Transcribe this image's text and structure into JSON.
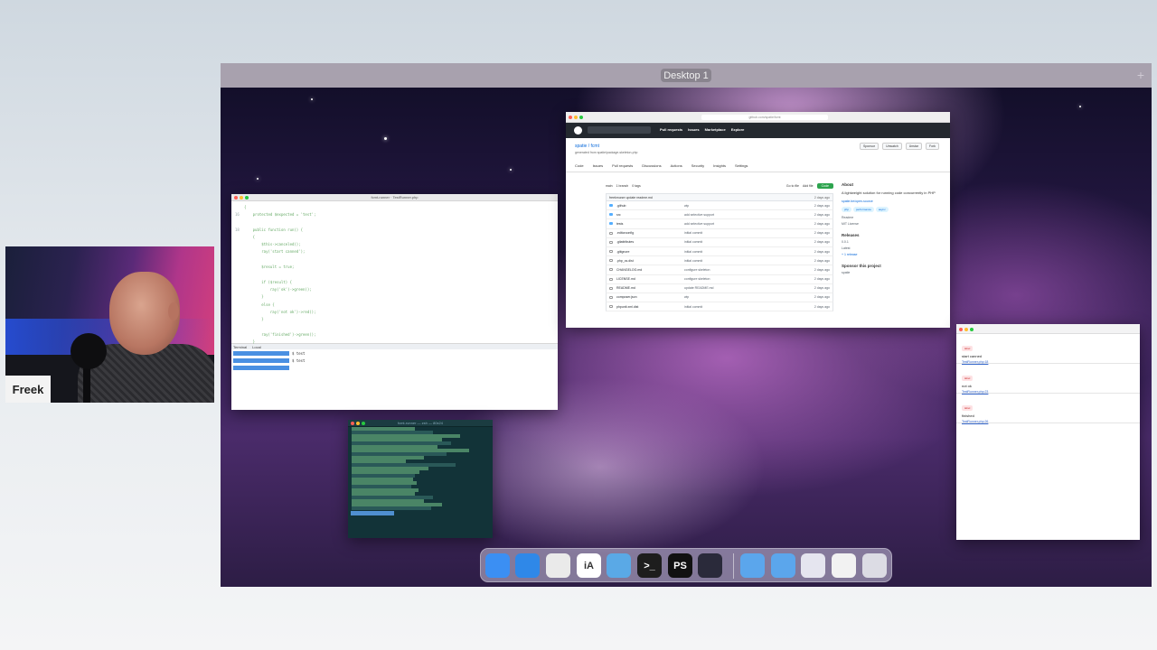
{
  "presenter": {
    "name": "Freek"
  },
  "mission_control": {
    "space_label": "Desktop 1",
    "add_space": "+"
  },
  "editor": {
    "title": "fcmt-runner · TestRunner.php",
    "code_lines": [
      {
        "n": "",
        "t": "{"
      },
      {
        "n": "16",
        "t": "    protected $expected = 'test';"
      },
      {
        "n": "",
        "t": ""
      },
      {
        "n": "18",
        "t": "    public function run() {"
      },
      {
        "n": "",
        "t": "    {"
      },
      {
        "n": "",
        "t": "        $this->canceled();"
      },
      {
        "n": "",
        "t": "        ray('start canned');"
      },
      {
        "n": "",
        "t": ""
      },
      {
        "n": "",
        "t": "        $result = true;"
      },
      {
        "n": "",
        "t": ""
      },
      {
        "n": "",
        "t": "        if ($result) {"
      },
      {
        "n": "",
        "t": "            ray('ok')->green();"
      },
      {
        "n": "",
        "t": "        }"
      },
      {
        "n": "",
        "t": "        else {"
      },
      {
        "n": "",
        "t": "            ray('not ok')->red();"
      },
      {
        "n": "",
        "t": "        }"
      },
      {
        "n": "",
        "t": ""
      },
      {
        "n": "",
        "t": "        ray('finished')->green();"
      },
      {
        "n": "",
        "t": "    }"
      }
    ],
    "term_tabs": [
      "Terminal",
      "Local"
    ],
    "term_rows": [
      "$ test",
      "$ test",
      ""
    ]
  },
  "browser": {
    "url": "github.com/spatie/fcmt",
    "nav": [
      "Pull requests",
      "Issues",
      "Marketplace",
      "Explore"
    ],
    "repo": "spatie / fcmt",
    "repo_sub": "generated from spatie/package-skeleton-php",
    "actions": [
      "Sponsor",
      "Unwatch",
      "Unstar",
      "Fork"
    ],
    "tabs": [
      "Code",
      "Issues",
      "Pull requests",
      "Discussions",
      "Actions",
      "Security",
      "Insights",
      "Settings"
    ],
    "branch": "main",
    "branches": "1 branch",
    "tags": "0 tags",
    "go_to_file": "Go to file",
    "add_file": "Add file",
    "code_btn": "Code",
    "commit_message": "freekmurze update readme.md",
    "commit_time": "2 days ago",
    "files": [
      {
        "name": ".github",
        "msg": "wip",
        "date": "2 days ago",
        "type": "dir"
      },
      {
        "name": "src",
        "msg": "add selective support",
        "date": "2 days ago",
        "type": "dir"
      },
      {
        "name": "tests",
        "msg": "add selective support",
        "date": "2 days ago",
        "type": "dir"
      },
      {
        "name": ".editorconfig",
        "msg": "initial commit",
        "date": "2 days ago",
        "type": "file"
      },
      {
        "name": ".gitattributes",
        "msg": "initial commit",
        "date": "2 days ago",
        "type": "file"
      },
      {
        "name": ".gitignore",
        "msg": "initial commit",
        "date": "2 days ago",
        "type": "file"
      },
      {
        "name": ".php_cs.dist",
        "msg": "initial commit",
        "date": "2 days ago",
        "type": "file"
      },
      {
        "name": "CHANGELOG.md",
        "msg": "configure skeleton",
        "date": "2 days ago",
        "type": "file"
      },
      {
        "name": "LICENSE.md",
        "msg": "configure skeleton",
        "date": "2 days ago",
        "type": "file"
      },
      {
        "name": "README.md",
        "msg": "update README.md",
        "date": "2 days ago",
        "type": "file"
      },
      {
        "name": "composer.json",
        "msg": "wip",
        "date": "2 days ago",
        "type": "file"
      },
      {
        "name": "phpunit.xml.dist",
        "msg": "initial commit",
        "date": "2 days ago",
        "type": "file"
      }
    ],
    "about": {
      "heading": "About",
      "description": "A lightweight solution for running code concurrently in PHP",
      "link": "spatie.be/open-source",
      "topics": [
        "php",
        "performance",
        "async"
      ],
      "readme": "Readme",
      "license": "MIT License",
      "releases_heading": "Releases",
      "release_tag": "0.0.1",
      "release_latest": "Latest",
      "create_release": "+ 1 release",
      "sponsor_heading": "Sponsor this project",
      "sponsor_name": "spatie"
    }
  },
  "notes": {
    "items": [
      {
        "badge": "label",
        "text": "start canned",
        "link": "TestRunner.php:18"
      },
      {
        "badge": "label",
        "text": "not ok",
        "link": "TestRunner.php:23"
      },
      {
        "badge": "label",
        "text": "finished",
        "link": "TestRunner.php:26"
      }
    ]
  },
  "terminal": {
    "title": "fcmt-runner — zsh — 80x24"
  },
  "dock": {
    "apps": [
      {
        "name": "finder",
        "label": "",
        "color": "#3b8ff3"
      },
      {
        "name": "safari",
        "label": "",
        "color": "#2f88e8"
      },
      {
        "name": "chrome",
        "label": "",
        "color": "#eaeaea"
      },
      {
        "name": "ia-writer",
        "label": "iA",
        "color": "#ffffff"
      },
      {
        "name": "tweetbot",
        "label": "",
        "color": "#5aa9e6"
      },
      {
        "name": "terminal",
        "label": ">_",
        "color": "#1d1d1d"
      },
      {
        "name": "phpstorm",
        "label": "PS",
        "color": "#111111"
      },
      {
        "name": "sublime",
        "label": "",
        "color": "#2a2a3a"
      },
      {
        "name": "downloads-folder",
        "label": "",
        "color": "#5ba6ec"
      },
      {
        "name": "documents-folder",
        "label": "",
        "color": "#5ba6ec"
      },
      {
        "name": "recent-stack",
        "label": "",
        "color": "#e5e5ef"
      },
      {
        "name": "document-stack",
        "label": "",
        "color": "#f2f2f2"
      },
      {
        "name": "trash",
        "label": "",
        "color": "#dcdce4"
      }
    ]
  }
}
